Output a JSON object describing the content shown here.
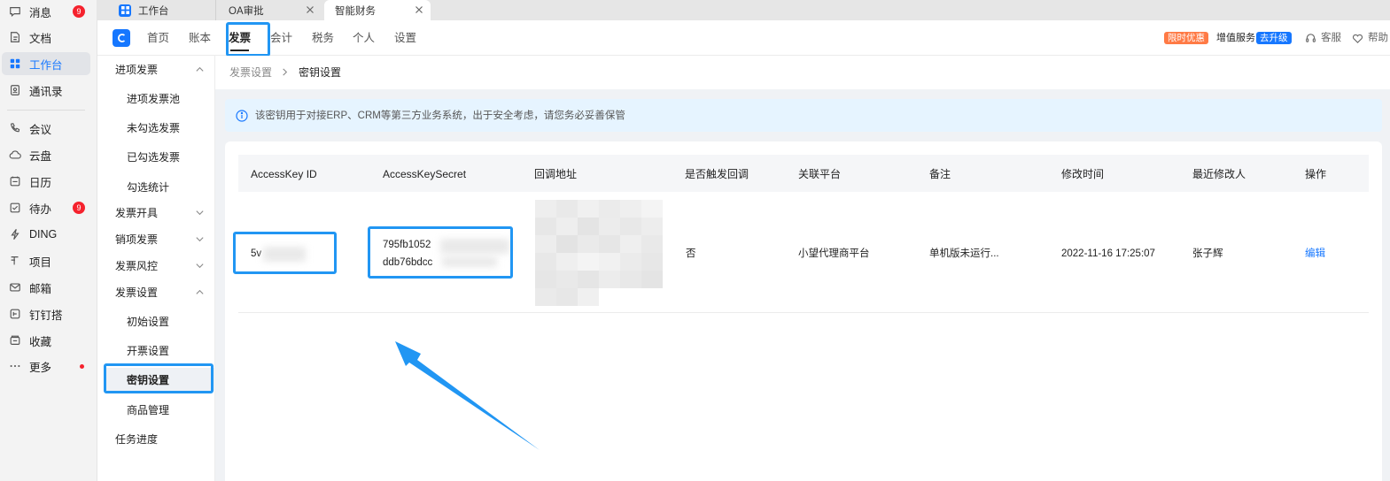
{
  "app_sidebar": {
    "items": [
      {
        "label": "消息",
        "icon": "chat-bubble-icon",
        "badge": "9"
      },
      {
        "label": "文档",
        "icon": "document-icon"
      },
      {
        "label": "工作台",
        "icon": "grid-icon",
        "active": true
      },
      {
        "label": "通讯录",
        "icon": "contacts-icon"
      },
      {
        "label": "会议",
        "icon": "phone-icon"
      },
      {
        "label": "云盘",
        "icon": "cloud-icon"
      },
      {
        "label": "日历",
        "icon": "calendar-icon"
      },
      {
        "label": "待办",
        "icon": "checkbox-icon",
        "badge": "9"
      },
      {
        "label": "DING",
        "icon": "lightning-icon"
      },
      {
        "label": "项目",
        "icon": "project-icon"
      },
      {
        "label": "邮箱",
        "icon": "mail-icon"
      },
      {
        "label": "钉钉搭",
        "icon": "builder-icon"
      },
      {
        "label": "收藏",
        "icon": "favorites-icon"
      },
      {
        "label": "更多",
        "icon": "more-dots-icon",
        "dot": true
      }
    ]
  },
  "tabs": [
    {
      "label": "工作台"
    },
    {
      "label": "OA审批"
    },
    {
      "label": "智能财务",
      "active": true
    }
  ],
  "topnav": {
    "items": [
      {
        "label": "首页"
      },
      {
        "label": "账本"
      },
      {
        "label": "发票",
        "active": true
      },
      {
        "label": "会计"
      },
      {
        "label": "税务"
      },
      {
        "label": "个人"
      },
      {
        "label": "设置"
      }
    ],
    "promo_badge": "限时优惠",
    "vas_label": "增值服务",
    "upgrade_badge": "去升级",
    "service_label": "客服",
    "help_label": "帮助"
  },
  "submenu": {
    "incoming_group": "进项发票",
    "incoming_pool": "进项发票池",
    "unchecked": "未勾选发票",
    "checked": "已勾选发票",
    "check_stats": "勾选统计",
    "issue_group": "发票开具",
    "sales_group": "销项发票",
    "risk_group": "发票风控",
    "settings_group": "发票设置",
    "initial_settings": "初始设置",
    "issue_settings": "开票设置",
    "key_settings": "密钥设置",
    "product_mgmt": "商品管理",
    "task_progress": "任务进度"
  },
  "breadcrumb": {
    "parent": "发票设置",
    "current": "密钥设置"
  },
  "info_banner": {
    "text": "该密钥用于对接ERP、CRM等第三方业务系统，出于安全考虑，请您务必妥善保管"
  },
  "table": {
    "headers": [
      "AccessKey ID",
      "AccessKeySecret",
      "回调地址",
      "是否触发回调",
      "关联平台",
      "备注",
      "修改时间",
      "最近修改人",
      "操作"
    ],
    "row": {
      "access_key_id": "5v",
      "secret_line1": "795fb1052",
      "secret_line2": "ddb76bdcc",
      "trigger_callback": "否",
      "platform": "小望代理商平台",
      "remark": "单机版未运行...",
      "modified_time": "2022-11-16 17:25:07",
      "modifier": "张子辉",
      "action": "编辑"
    }
  },
  "colors": {
    "accent": "#1677ff",
    "highlight": "#2196f3",
    "promo": "#ff7a45",
    "badge": "#f5222d"
  }
}
